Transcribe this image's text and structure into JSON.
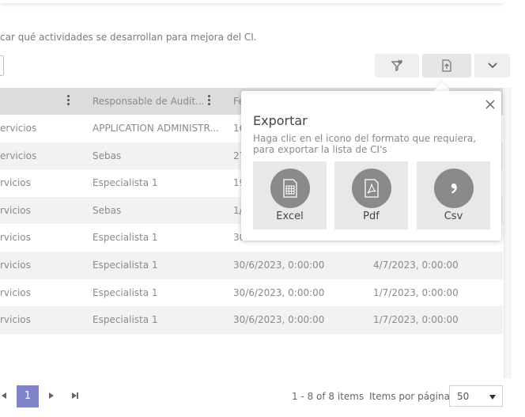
{
  "description": "car qué actividades se desarrollan para mejora del CI.",
  "table": {
    "headers": {
      "responsable": "Responsable de Audit...",
      "fecha": "Fe"
    },
    "rows": [
      {
        "serv": "ervicios",
        "resp": "APPLICATION ADMINISTR...",
        "f1": "16",
        "f2": ""
      },
      {
        "serv": "ervicios",
        "resp": "Sebas",
        "f1": "27",
        "f2": ""
      },
      {
        "serv": "rvicios",
        "resp": "Especialista 1",
        "f1": "19",
        "f2": ""
      },
      {
        "serv": "rvicios",
        "resp": "Sebas",
        "f1": "1/",
        "f2": ""
      },
      {
        "serv": "rvicios",
        "resp": "Especialista 1",
        "f1": "30",
        "f2": ""
      },
      {
        "serv": "rvicios",
        "resp": "Especialista 1",
        "f1": "30/6/2023, 0:00:00",
        "f2": "4/7/2023, 0:00:00"
      },
      {
        "serv": "rvicios",
        "resp": "Especialista 1",
        "f1": "30/6/2023, 0:00:00",
        "f2": "1/7/2023, 0:00:00"
      },
      {
        "serv": "rvicios",
        "resp": "Especialista 1",
        "f1": "30/6/2023, 0:00:00",
        "f2": "1/7/2023, 0:00:00"
      }
    ]
  },
  "pager": {
    "current_page": "1",
    "info": "1 - 8 of 8 items",
    "items_per_page_label": "Items por página",
    "items_per_page_value": "50"
  },
  "export_popover": {
    "title": "Exportar",
    "description": "Haga clic en el icono del formato que requiera, para exportar la lista de CI's",
    "options": {
      "excel": "Excel",
      "pdf": "Pdf",
      "csv": "Csv"
    }
  },
  "icons": {
    "filter": "filter-clear-icon",
    "export": "file-export-icon",
    "more": "chevron-down-icon",
    "close": "close-icon",
    "excel": "spreadsheet-icon",
    "pdf": "pdf-icon",
    "csv": "comma-icon"
  },
  "colors": {
    "pager_active": "#7f83c9",
    "header_bg": "#dcdcdc",
    "option_bg": "#e8e8e8",
    "option_circle": "#8a8a8a"
  }
}
